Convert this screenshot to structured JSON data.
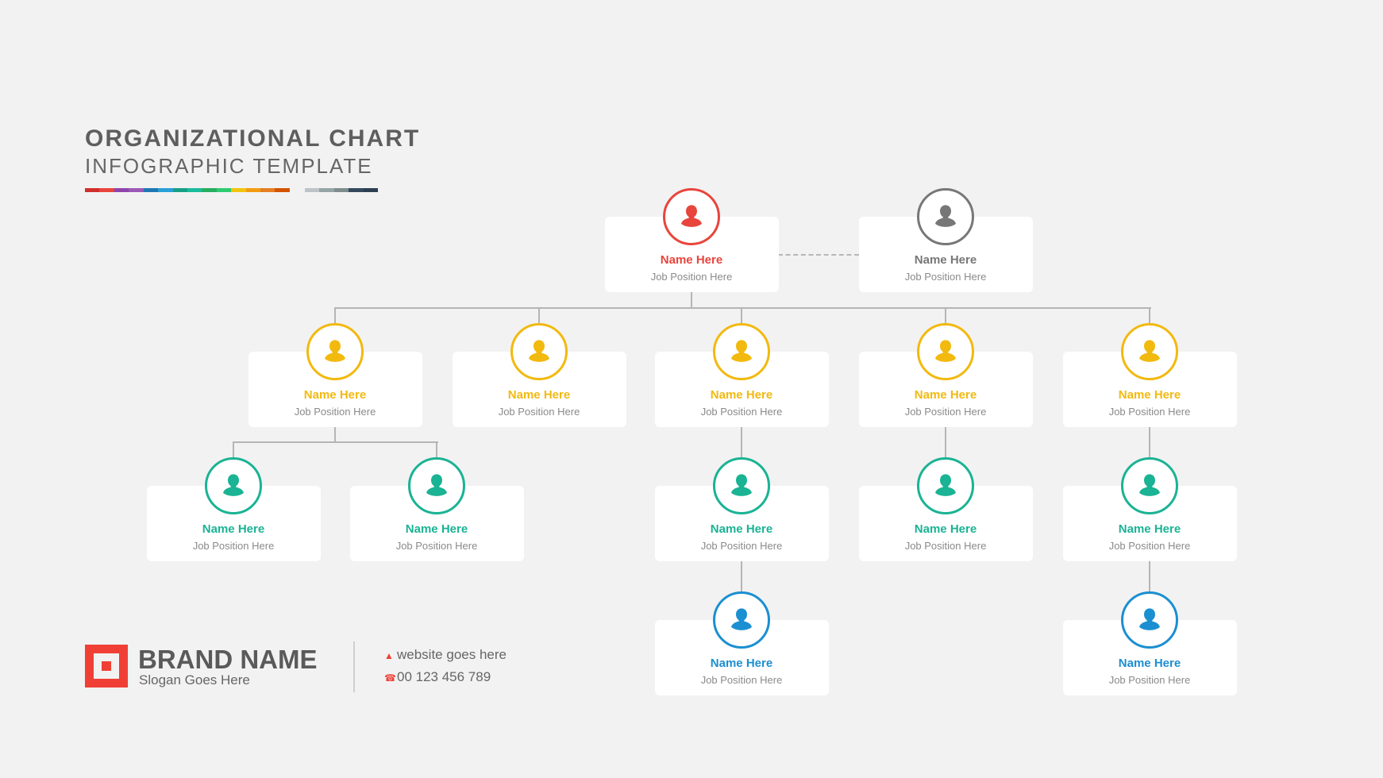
{
  "header": {
    "title": "ORGANIZATIONAL CHART",
    "subtitle": "INFOGRAPHIC TEMPLATE",
    "color_bar_main": [
      "#cf2f2b",
      "#e8453c",
      "#8e44ad",
      "#9b59b6",
      "#1f78b4",
      "#2a9fd8",
      "#16a085",
      "#1abc9c",
      "#27ae60",
      "#2ecc71",
      "#f1c40f",
      "#f39c12",
      "#e67e22",
      "#d35400"
    ],
    "color_bar_secondary": [
      "#bdc3c7",
      "#95a5a6",
      "#7f8c8d",
      "#34495e",
      "#2c3e50"
    ]
  },
  "colors": {
    "red": "#e8453c",
    "gray": "#777777",
    "yellow": "#f2b90f",
    "green": "#1ab394",
    "blue": "#1b8fd1",
    "text_muted": "#8a8a8a"
  },
  "nodes": {
    "ceo": {
      "name": "Name Here",
      "position": "Job Position Here",
      "color": "#e8453c"
    },
    "assistant": {
      "name": "Name Here",
      "position": "Job Position Here",
      "color": "#777777"
    },
    "level2": [
      {
        "name": "Name Here",
        "position": "Job Position Here",
        "color": "#f2b90f"
      },
      {
        "name": "Name Here",
        "position": "Job Position Here",
        "color": "#f2b90f"
      },
      {
        "name": "Name Here",
        "position": "Job Position Here",
        "color": "#f2b90f"
      },
      {
        "name": "Name Here",
        "position": "Job Position Here",
        "color": "#f2b90f"
      },
      {
        "name": "Name Here",
        "position": "Job Position Here",
        "color": "#f2b90f"
      }
    ],
    "level3": [
      {
        "name": "Name Here",
        "position": "Job Position Here",
        "color": "#1ab394"
      },
      {
        "name": "Name Here",
        "position": "Job Position Here",
        "color": "#1ab394"
      },
      {
        "name": "Name Here",
        "position": "Job Position Here",
        "color": "#1ab394"
      },
      {
        "name": "Name Here",
        "position": "Job Position Here",
        "color": "#1ab394"
      },
      {
        "name": "Name Here",
        "position": "Job Position Here",
        "color": "#1ab394"
      }
    ],
    "level4": [
      {
        "name": "Name Here",
        "position": "Job Position Here",
        "color": "#1b8fd1"
      },
      {
        "name": "Name Here",
        "position": "Job Position Here",
        "color": "#1b8fd1"
      }
    ]
  },
  "footer": {
    "brand_name": "BRAND NAME",
    "slogan": "Slogan Goes Here",
    "website": "website goes here",
    "phone": "00 123 456 789",
    "website_icon": "cursor-icon",
    "phone_icon": "phone-icon"
  }
}
